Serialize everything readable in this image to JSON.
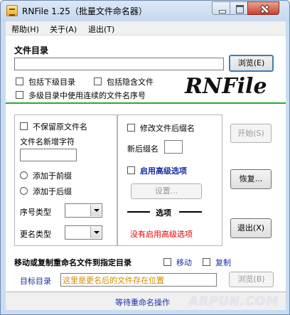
{
  "window": {
    "title": "RNFile 1.25（批量文件命名器）"
  },
  "menu": {
    "items": [
      "帮助(H)",
      "关于(A)",
      "退出(T)"
    ]
  },
  "directory": {
    "section_label": "文件目录",
    "path_value": "",
    "browse_label": "浏览(E)",
    "include_subdirs": "包括下级目录",
    "include_hidden": "包括隐含文件",
    "continuous_numbering": "多级目录中使用连续的文件名序号",
    "logo_text": "RNFile"
  },
  "left_panel": {
    "keep_original": "不保留原文件名",
    "new_chars_label": "文件名新增字符",
    "new_chars_value": "",
    "add_prefix": "添加于前缀",
    "add_suffix": "添加于后缀",
    "seq_type_label": "序号类型",
    "rename_type_label": "更名类型"
  },
  "middle_panel": {
    "modify_ext": "修改文件后缀名",
    "new_ext_label": "新后缀名",
    "enable_advanced": "启用高级选项",
    "settings_label": "设置...",
    "options_title": "选项",
    "options_status": "没有启用高级选项"
  },
  "actions": {
    "start_label": "开始(S)",
    "restore_label": "恢复...",
    "exit_label": "退出(X)"
  },
  "move_copy": {
    "title": "移动或复制重命名文件到指定目录",
    "move_label": "移动",
    "copy_label": "复制",
    "target_label": "目标目录",
    "target_placeholder": "这里是更名后的文件存在位置",
    "browse_label": "浏览(B)"
  },
  "status": {
    "text": "等待重命名操作"
  },
  "watermark": "ARPUN.COM",
  "colors": {
    "accent_red": "#e60000",
    "accent_blue": "#1a2fa6",
    "green_line": "#2aa836",
    "placeholder_orange": "#d28a00"
  }
}
